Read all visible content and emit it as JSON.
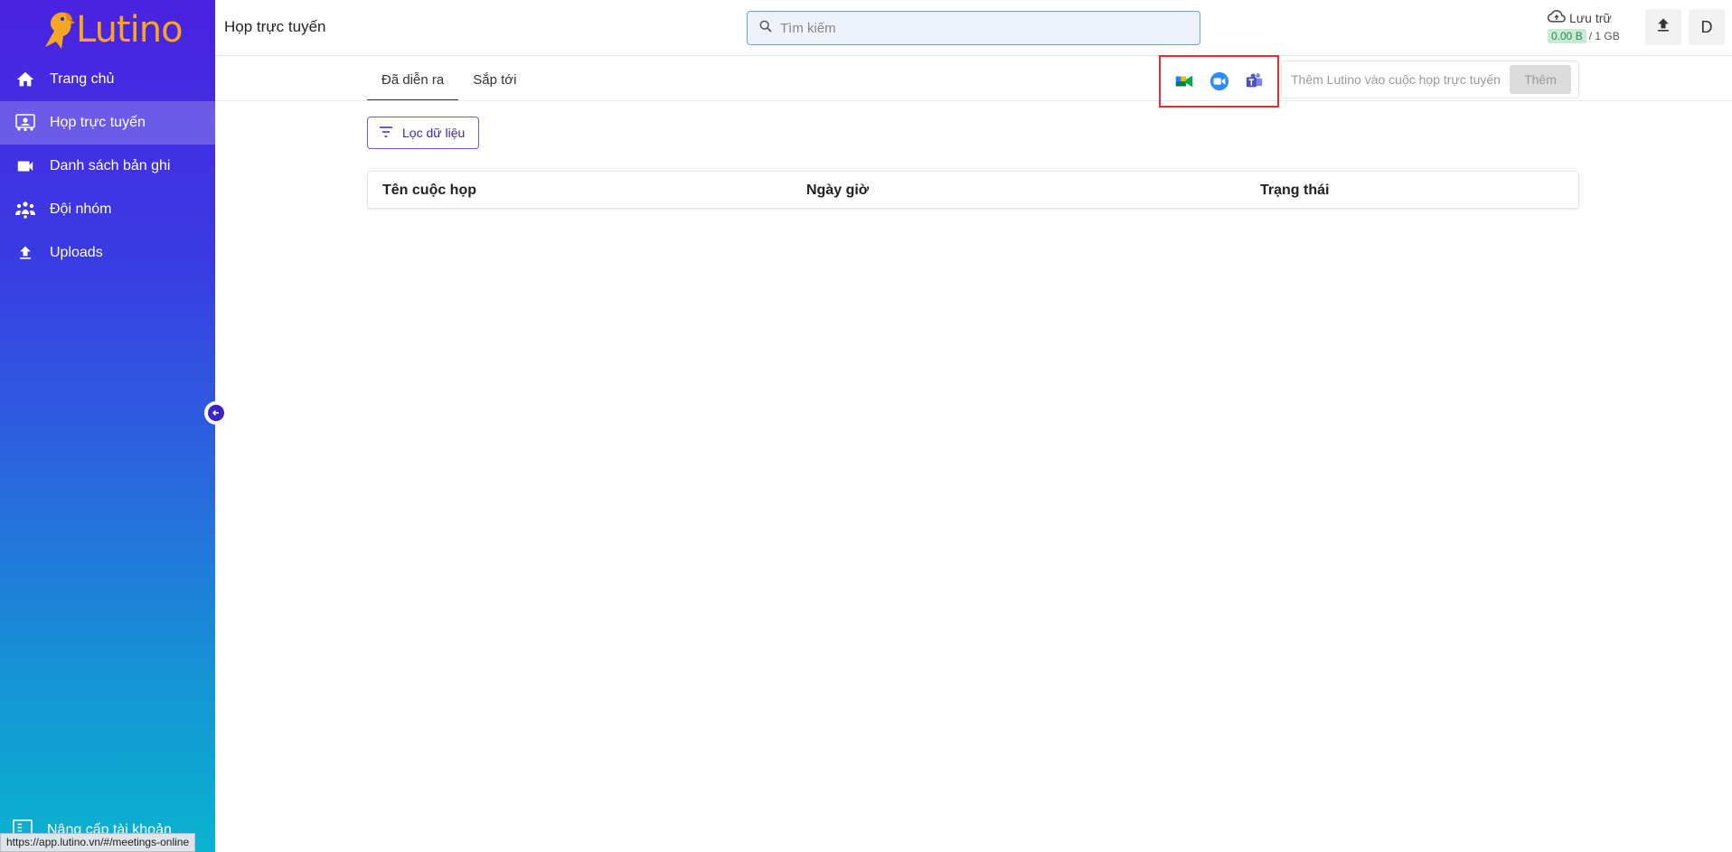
{
  "sidebar": {
    "logo_text": "Lutino",
    "items": [
      {
        "label": "Trang chủ",
        "icon": "home-icon",
        "active": false
      },
      {
        "label": "Họp trực tuyến",
        "icon": "meeting-icon",
        "active": true
      },
      {
        "label": "Danh sách bản ghi",
        "icon": "video-camera-icon",
        "active": false
      },
      {
        "label": "Đội nhóm",
        "icon": "group-icon",
        "active": false
      },
      {
        "label": "Uploads",
        "icon": "upload-icon",
        "active": false
      }
    ],
    "upgrade_label": "Nâng cấp tài khoản"
  },
  "status_url": "https://app.lutino.vn/#/meetings-online",
  "header": {
    "page_title": "Họp trực tuyến",
    "search_placeholder": "Tìm kiếm",
    "storage_label": "Lưu trữ",
    "storage_used": "0.00 B",
    "storage_total": "/ 1 GB",
    "avatar_letter": "D"
  },
  "tabs": [
    {
      "label": "Đã diễn ra",
      "active": true
    },
    {
      "label": "Sắp tới",
      "active": false
    }
  ],
  "integrations": [
    "google-meet-icon",
    "zoom-icon",
    "microsoft-teams-icon"
  ],
  "add_bot": {
    "placeholder": "Thêm Lutino vào cuộc họp trực tuyến",
    "button_label": "Thêm"
  },
  "filter_label": "Lọc dữ liệu",
  "table": {
    "columns": [
      "Tên cuộc họp",
      "Ngày giờ",
      "Trạng thái"
    ]
  },
  "colors": {
    "accent": "#3b22c9",
    "highlight_border": "#e03131",
    "logo": "#f5a623"
  }
}
